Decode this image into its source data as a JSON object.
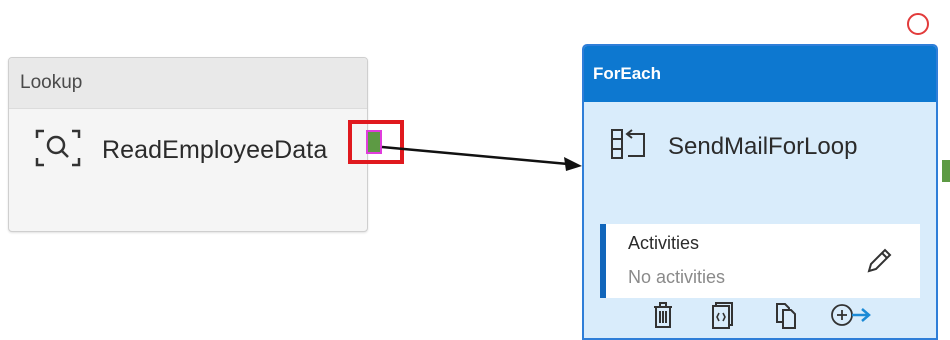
{
  "lookup": {
    "header": "Lookup",
    "activity_name": "ReadEmployeeData",
    "icon": "search-icon"
  },
  "connector": {
    "from": "ReadEmployeeData",
    "to": "SendMailForLoop",
    "port_color": "#5d9a44",
    "highlight_color": "#e0191e"
  },
  "foreach": {
    "header": "ForEach",
    "activity_name": "SendMailForLoop",
    "icon": "foreach-loop-icon",
    "header_color": "#0d78d0",
    "body_color": "#d9ecfb",
    "activities": {
      "label": "Activities",
      "status": "No activities",
      "edit_icon": "pencil-icon"
    },
    "toolbar": [
      {
        "name": "delete",
        "icon": "trash-icon"
      },
      {
        "name": "view-code",
        "icon": "code-icon"
      },
      {
        "name": "clone",
        "icon": "copy-icon"
      },
      {
        "name": "add-output",
        "icon": "add-arrow-icon"
      }
    ]
  },
  "status": {
    "icon": "status-circle-icon",
    "color": "#e23b3b"
  }
}
